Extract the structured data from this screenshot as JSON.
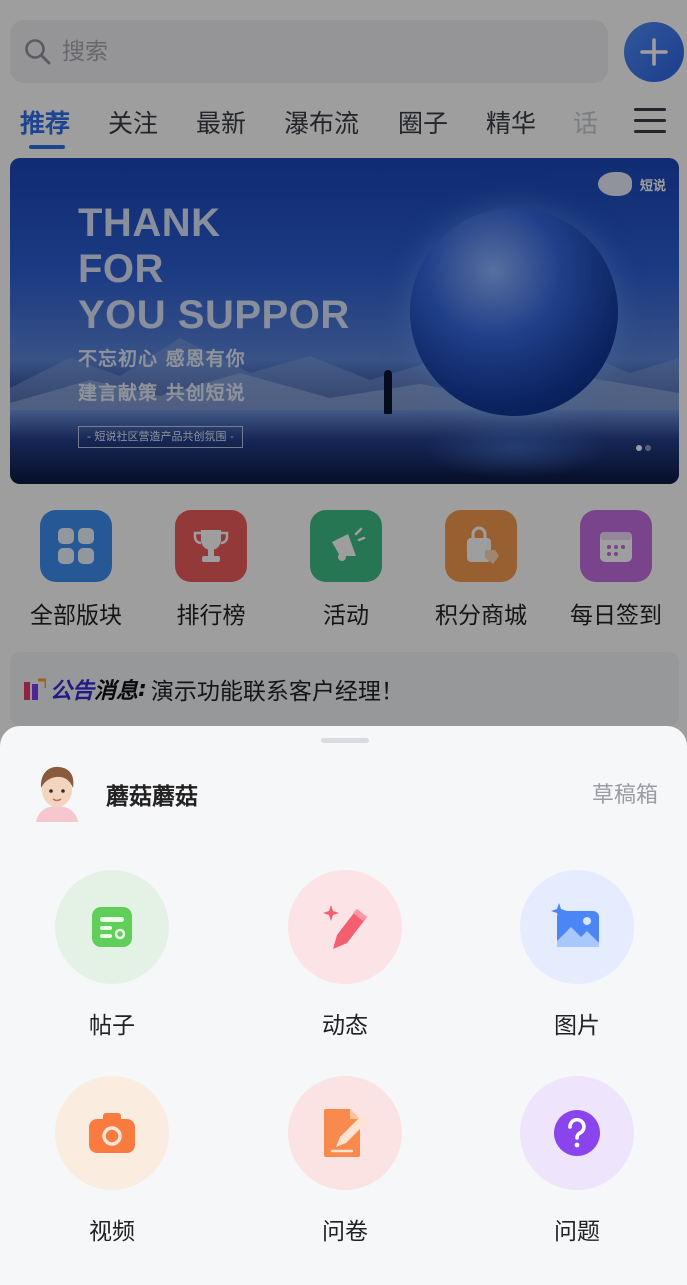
{
  "search": {
    "placeholder": "搜索"
  },
  "tabs": [
    {
      "label": "推荐",
      "active": true
    },
    {
      "label": "关注"
    },
    {
      "label": "最新"
    },
    {
      "label": "瀑布流"
    },
    {
      "label": "圈子"
    },
    {
      "label": "精华"
    },
    {
      "label": "话"
    }
  ],
  "banner": {
    "headline": "THANK\nFOR\nYOU SUPPOR",
    "line1": "不忘初心 感恩有你",
    "line2": "建言献策 共创短说",
    "tagline": "- 短说社区营造产品共创氛围 -",
    "brand": "短说",
    "slide_count": 2,
    "active_slide": 1
  },
  "quick_actions": [
    {
      "label": "全部版块",
      "icon": "grid-icon",
      "color": "#3d8ff0"
    },
    {
      "label": "排行榜",
      "icon": "trophy-icon",
      "color": "#ef5d5d"
    },
    {
      "label": "活动",
      "icon": "megaphone-icon",
      "color": "#3ebf86"
    },
    {
      "label": "积分商城",
      "icon": "shopping-bag-icon",
      "color": "#f59a4e"
    },
    {
      "label": "每日签到",
      "icon": "calendar-icon",
      "color": "#c46ee0"
    }
  ],
  "notice": {
    "tag_part1": "公告",
    "tag_part2": "消息",
    "message": "演示功能联系客户经理！"
  },
  "sheet": {
    "username": "蘑菇蘑菇",
    "drafts": "草稿箱",
    "options": [
      {
        "label": "帖子",
        "icon": "post-icon"
      },
      {
        "label": "动态",
        "icon": "pen-sparkle-icon"
      },
      {
        "label": "图片",
        "icon": "image-icon"
      },
      {
        "label": "视频",
        "icon": "camera-icon"
      },
      {
        "label": "问卷",
        "icon": "survey-icon"
      },
      {
        "label": "问题",
        "icon": "question-icon"
      }
    ]
  }
}
